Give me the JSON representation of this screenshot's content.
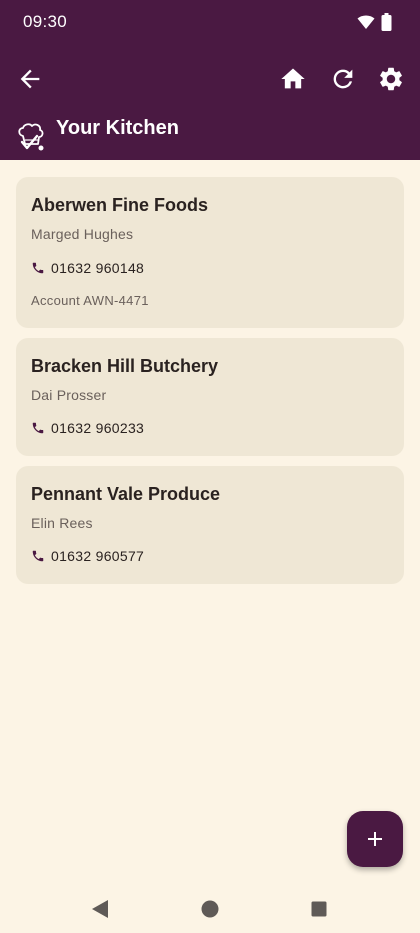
{
  "status_bar": {
    "time": "09:30"
  },
  "header": {
    "title": "Your Kitchen"
  },
  "icons": {
    "back": "arrow-back-icon",
    "home": "home-icon",
    "refresh": "refresh-icon",
    "settings": "gear-icon",
    "logo": "chef-hat-check-icon",
    "phone": "phone-icon",
    "add": "plus-icon"
  },
  "colors": {
    "primary": "#4a1942",
    "background": "#fcf4e5",
    "card": "#efe7d5"
  },
  "suppliers": [
    {
      "name": "Aberwen Fine Foods",
      "contact": "Marged Hughes",
      "phone": "01632 960148",
      "account": "Account AWN-4471"
    },
    {
      "name": "Bracken Hill Butchery",
      "contact": "Dai Prosser",
      "phone": "01632 960233"
    },
    {
      "name": "Pennant Vale Produce",
      "contact": "Elin Rees",
      "phone": "01632 960577"
    }
  ]
}
